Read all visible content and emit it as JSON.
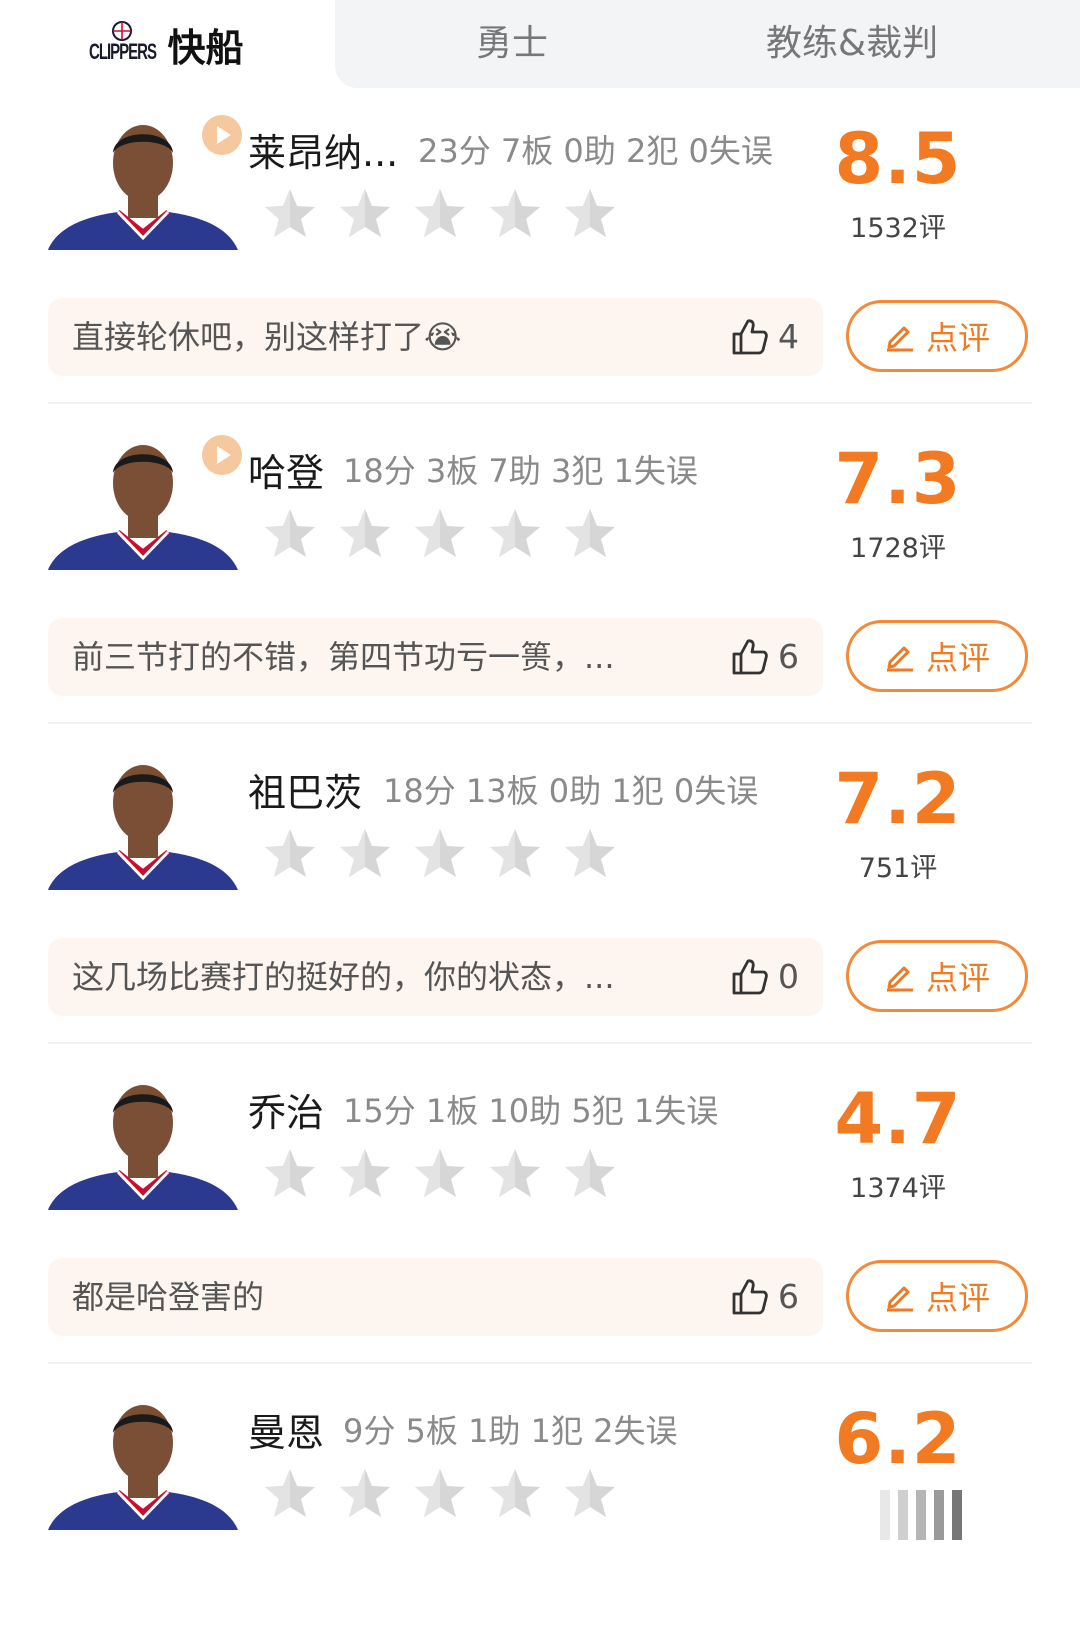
{
  "tabs": {
    "logo_text": "CLIPPERS",
    "active": "快船",
    "other": [
      "勇士",
      "教练&裁判"
    ]
  },
  "players": [
    {
      "name": "莱昂纳...",
      "stats": "23分 7板 0助 2犯 0失误",
      "score": "8.5",
      "count": "1532评",
      "has_video": true,
      "comment": "直接轮休吧，别这样打了😭",
      "likes": "4",
      "review_label": "点评"
    },
    {
      "name": "哈登",
      "stats": "18分 3板 7助 3犯 1失误",
      "score": "7.3",
      "count": "1728评",
      "has_video": true,
      "comment": "前三节打的不错，第四节功亏一篑，...",
      "likes": "6",
      "review_label": "点评"
    },
    {
      "name": "祖巴茨",
      "stats": "18分 13板 0助 1犯 0失误",
      "score": "7.2",
      "count": "751评",
      "has_video": false,
      "comment": "这几场比赛打的挺好的，你的状态，...",
      "likes": "0",
      "review_label": "点评"
    },
    {
      "name": "乔治",
      "stats": "15分 1板 10助 5犯 1失误",
      "score": "4.7",
      "count": "1374评",
      "has_video": false,
      "comment": "都是哈登害的",
      "likes": "6",
      "review_label": "点评"
    },
    {
      "name": "曼恩",
      "stats": "9分 5板 1助 1犯 2失误",
      "score": "6.2",
      "count": "",
      "has_video": false
    }
  ],
  "colors": {
    "accent": "#f27a22",
    "star_empty": "#d9d9d9",
    "jersey": "#2b3a8f",
    "comment_bg": "#fdf5ef"
  },
  "icons": [
    "play-icon",
    "star-icon",
    "thumbs-up-icon",
    "edit-pencil-icon",
    "clippers-logo"
  ]
}
